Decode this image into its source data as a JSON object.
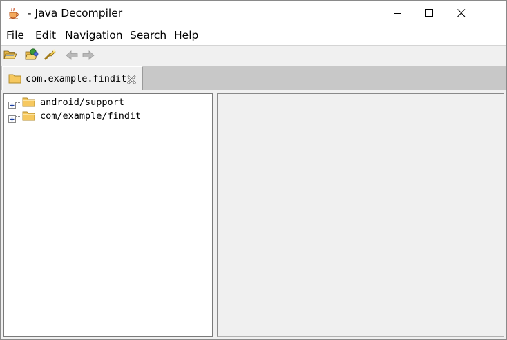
{
  "window": {
    "title": "- Java Decompiler",
    "app_icon": "coffee-cup-icon",
    "controls": [
      "minimize-icon",
      "maximize-icon",
      "close-icon"
    ]
  },
  "menu": {
    "items": [
      "File",
      "Edit",
      "Navigation",
      "Search",
      "Help"
    ]
  },
  "toolbar": {
    "buttons": [
      "open-file-icon",
      "open-type-icon",
      "search-icon",
      "back-arrow-icon",
      "forward-arrow-icon"
    ]
  },
  "tabs": [
    {
      "label": "com.example.findit",
      "icon": "folder-icon",
      "close_icon": "tab-close-icon"
    }
  ],
  "tree": {
    "items": [
      {
        "label": "android/support",
        "expander": "plus",
        "icon": "folder-icon"
      },
      {
        "label": "com/example/findit",
        "expander": "plus",
        "icon": "folder-icon"
      }
    ]
  },
  "colors": {
    "tab_strip": "#c8c8c8",
    "folder": "#f6c85f",
    "panel": "#f0f0f0"
  }
}
